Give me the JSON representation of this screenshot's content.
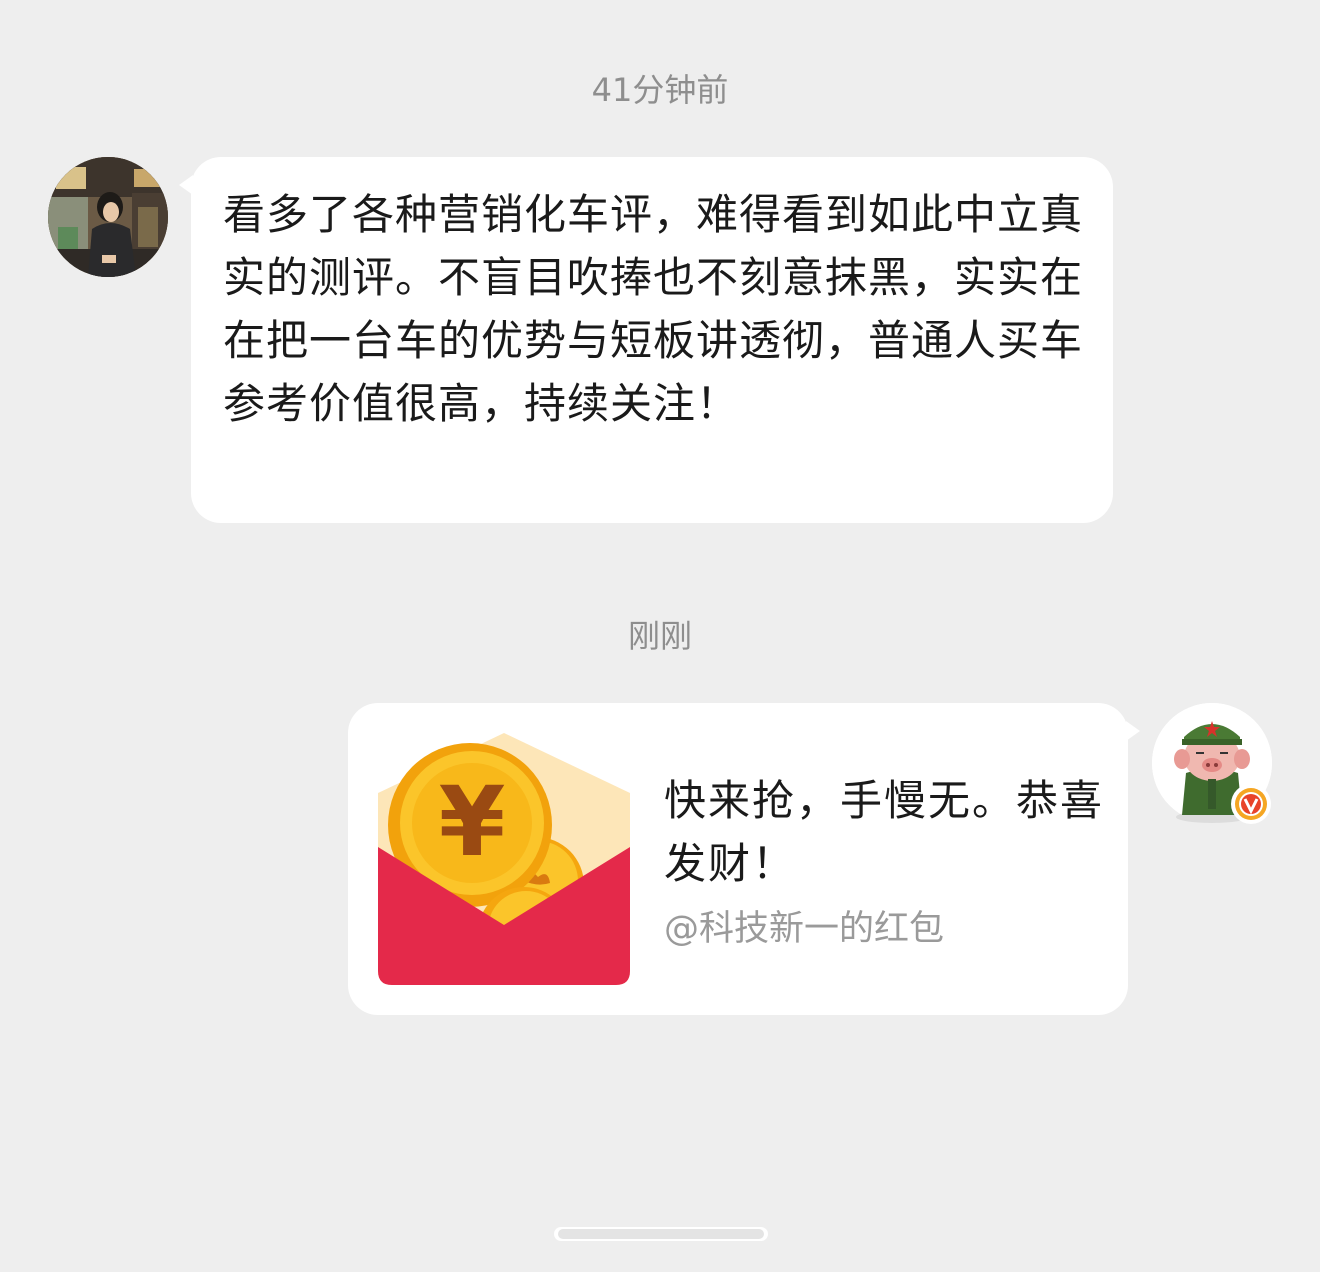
{
  "messages": [
    {
      "timestamp": "41分钟前",
      "sender": "other",
      "text": " 看多了各种营销化车评，难得看到如此中立真实的测评。不盲目吹捧也不刻意抹黑，实实在在把一台车的优势与短板讲透彻，普通人买车参考价值很高，持续关注！"
    },
    {
      "timestamp": "刚刚",
      "sender": "self",
      "red_packet": {
        "title": "快来抢，手慢无。恭喜发财！",
        "subtitle": "@科技新一的红包",
        "currency_symbol": "¥"
      }
    }
  ],
  "icons": {
    "avatar_left": "user-avatar-photo",
    "avatar_right": "cartoon-pig-soldier-avatar",
    "verified_badge": "verified-v-badge",
    "envelope": "red-packet-envelope-icon"
  },
  "colors": {
    "background": "#eeeeee",
    "bubble": "#ffffff",
    "timestamp_text": "#8e8e8e",
    "subtitle_text": "#9a9a9a",
    "envelope_red": "#e4294a",
    "coin_gold": "#f8c21a",
    "verified_orange": "#f5a623"
  }
}
